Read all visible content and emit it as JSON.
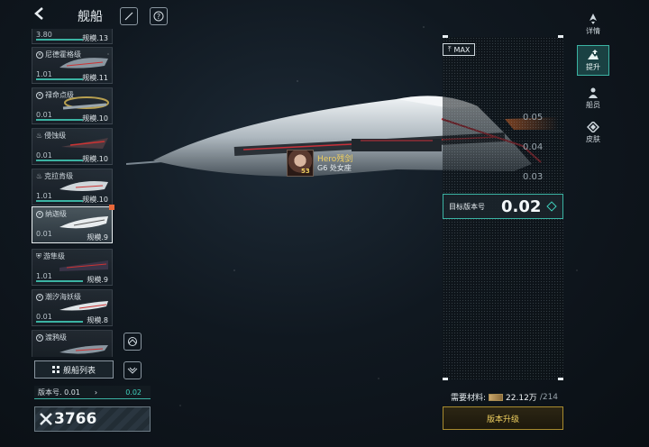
{
  "header": {
    "title": "舰船",
    "back_icon": "chevron-left-icon",
    "icons": [
      "feather-icon",
      "help-icon"
    ]
  },
  "ships": [
    {
      "class_name": "",
      "version": "3.80",
      "scale": "规模.13",
      "selected": false,
      "icon": "x-circle"
    },
    {
      "class_name": "尼德霍格级",
      "version": "1.01",
      "scale": "规模.11",
      "selected": false,
      "icon": "x-circle"
    },
    {
      "class_name": "禄命点级",
      "version": "0.01",
      "scale": "规模.10",
      "selected": false,
      "icon": "x-circle"
    },
    {
      "class_name": "侵蚀级",
      "version": "0.01",
      "scale": "规模.10",
      "selected": false,
      "icon": "flame"
    },
    {
      "class_name": "克拉肯级",
      "version": "1.01",
      "scale": "规模.10",
      "selected": false,
      "icon": "flame"
    },
    {
      "class_name": "纳迦级",
      "version": "0.01",
      "scale": "规模.9",
      "selected": true,
      "icon": "x-circle"
    },
    {
      "class_name": "游隼级",
      "version": "1.01",
      "scale": "规模.9",
      "selected": false,
      "icon": "shield"
    },
    {
      "class_name": "潮汐海妖级",
      "version": "0.01",
      "scale": "规模.8",
      "selected": false,
      "icon": "x-circle"
    },
    {
      "class_name": "渡鸦级",
      "version": "",
      "scale": "",
      "selected": false,
      "icon": "x-circle"
    }
  ],
  "fleet": {
    "list_label": "舰船列表",
    "version_label": "版本号. 0.01",
    "version_arrow": "›",
    "version_next": "0.02",
    "power_icon": "crossed-swords-icon",
    "power_value": "3766"
  },
  "captain": {
    "name": "Hero残剑",
    "subtitle": "G6 处女座",
    "level": "53"
  },
  "upgrade": {
    "max_label": "MAX",
    "scale_ticks": [
      "0.05",
      "0.04",
      "0.03"
    ],
    "target_label": "目标版本号",
    "target_value": "0.02",
    "materials_label": "需要材料:",
    "materials_have": "22.12万",
    "materials_need": "/214",
    "upgrade_button": "版本升级"
  },
  "tabs": [
    {
      "label": "详情",
      "icon": "rocket-icon",
      "active": false
    },
    {
      "label": "提升",
      "icon": "mountain-up-icon",
      "active": true
    },
    {
      "label": "船员",
      "icon": "crew-icon",
      "active": false
    },
    {
      "label": "皮肤",
      "icon": "ship-skin-icon",
      "active": false
    }
  ],
  "colors": {
    "accent": "#3bb3a3",
    "gold": "#f0d060",
    "selected_badge": "#e8683a"
  }
}
